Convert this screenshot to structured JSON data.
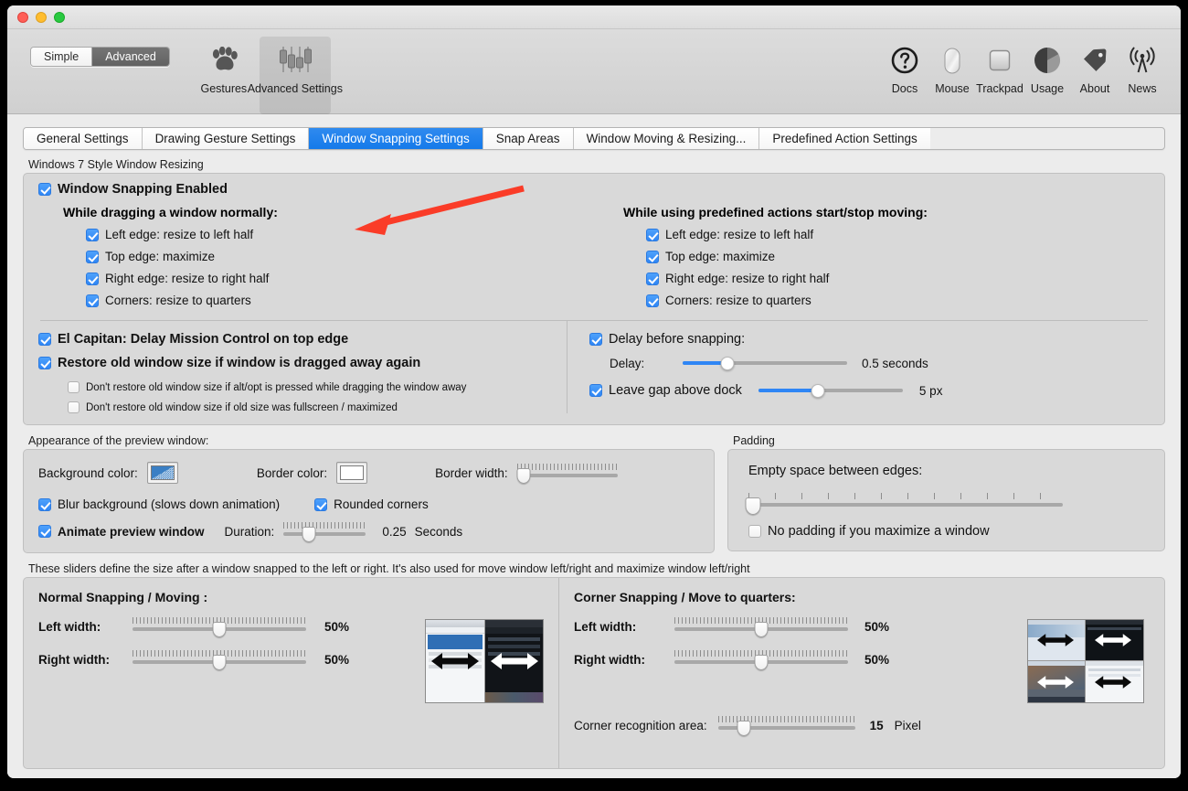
{
  "window": {
    "traffic_lights": [
      "close",
      "minimize",
      "zoom"
    ]
  },
  "toolbar": {
    "mode_segments": [
      {
        "label": "Simple",
        "active": false
      },
      {
        "label": "Advanced",
        "active": true
      }
    ],
    "left_items": [
      {
        "label": "Gestures",
        "icon": "paw-icon",
        "selected": false
      },
      {
        "label": "Advanced Settings",
        "icon": "sliders-icon",
        "selected": true
      }
    ],
    "right_items": [
      {
        "label": "Docs",
        "icon": "question-circle-icon"
      },
      {
        "label": "Mouse",
        "icon": "mouse-icon"
      },
      {
        "label": "Trackpad",
        "icon": "trackpad-icon"
      },
      {
        "label": "Usage",
        "icon": "pie-chart-icon"
      },
      {
        "label": "About",
        "icon": "tag-icon"
      },
      {
        "label": "News",
        "icon": "broadcast-icon"
      }
    ]
  },
  "tabs": [
    {
      "label": "General Settings",
      "active": false
    },
    {
      "label": "Drawing Gesture Settings",
      "active": false
    },
    {
      "label": "Window Snapping Settings",
      "active": true
    },
    {
      "label": "Snap Areas",
      "active": false
    },
    {
      "label": "Window Moving & Resizing...",
      "active": false
    },
    {
      "label": "Predefined Action Settings",
      "active": false
    }
  ],
  "snapping": {
    "group_title": "Windows 7 Style Window Resizing",
    "enabled_label": "Window Snapping Enabled",
    "enabled_checked": true,
    "left_column": {
      "heading": "While dragging a window normally:",
      "options": [
        {
          "label": "Left edge: resize to left half",
          "checked": true
        },
        {
          "label": "Top edge: maximize",
          "checked": true
        },
        {
          "label": "Right edge: resize to right half",
          "checked": true
        },
        {
          "label": "Corners: resize to quarters",
          "checked": true
        }
      ]
    },
    "right_column": {
      "heading": "While using predefined actions start/stop moving:",
      "options": [
        {
          "label": "Left edge: resize to left half",
          "checked": true
        },
        {
          "label": "Top edge: maximize",
          "checked": true
        },
        {
          "label": "Right edge: resize to right half",
          "checked": true
        },
        {
          "label": "Corners: resize to quarters",
          "checked": true
        }
      ]
    },
    "el_capitan": {
      "label": "El Capitan: Delay Mission Control on top edge",
      "checked": true
    },
    "restore": {
      "label": "Restore old window size if window is dragged away again",
      "checked": true
    },
    "restore_sub": [
      {
        "label": "Don't restore old window size if alt/opt is pressed while dragging the window away",
        "checked": false
      },
      {
        "label": "Don't restore old window size if old size was fullscreen / maximized",
        "checked": false
      }
    ],
    "delay": {
      "checkbox_label": "Delay before snapping:",
      "checked": true,
      "slider_label": "Delay:",
      "value": "0.5 seconds",
      "percent": 27
    },
    "gap": {
      "checkbox_label": "Leave gap above dock",
      "checked": true,
      "value": "5 px",
      "percent": 41
    }
  },
  "appearance": {
    "group_title": "Appearance of the preview window:",
    "background_color_label": "Background color:",
    "background_color": "#3a7fc4",
    "border_color_label": "Border color:",
    "border_color": "#ffffff",
    "border_width_label": "Border width:",
    "border_width_percent": 7,
    "blur": {
      "label": "Blur background (slows down animation)",
      "checked": true
    },
    "rounded": {
      "label": "Rounded corners",
      "checked": true
    },
    "animate": {
      "label": "Animate preview window",
      "checked": true
    },
    "duration_label": "Duration:",
    "duration_value": "0.25",
    "duration_unit": "Seconds",
    "duration_percent": 31
  },
  "padding": {
    "group_title": "Padding",
    "heading": "Empty space between edges:",
    "slider_percent": 1,
    "no_padding": {
      "label": "No padding if you maximize a window",
      "checked": false
    }
  },
  "sliders_section": {
    "caption": "These sliders define the size after a window snapped to the left or right. It's also used for move window left/right and maximize window left/right",
    "normal": {
      "heading": "Normal Snapping / Moving :",
      "rows": [
        {
          "label": "Left width:",
          "value": "50%",
          "percent": 50
        },
        {
          "label": "Right width:",
          "value": "50%",
          "percent": 50
        }
      ],
      "thumbnail": "two-pane-preview"
    },
    "corner": {
      "heading": "Corner Snapping / Move to quarters:",
      "rows": [
        {
          "label": "Left width:",
          "value": "50%",
          "percent": 50
        },
        {
          "label": "Right width:",
          "value": "50%",
          "percent": 50
        }
      ],
      "recognition": {
        "label": "Corner recognition area:",
        "value": "15",
        "unit": "Pixel",
        "percent": 19
      },
      "thumbnail": "four-quadrant-preview"
    }
  },
  "annotation": {
    "type": "red-arrow",
    "points_to": "While dragging a window normally:",
    "color": "#fa3c28"
  }
}
